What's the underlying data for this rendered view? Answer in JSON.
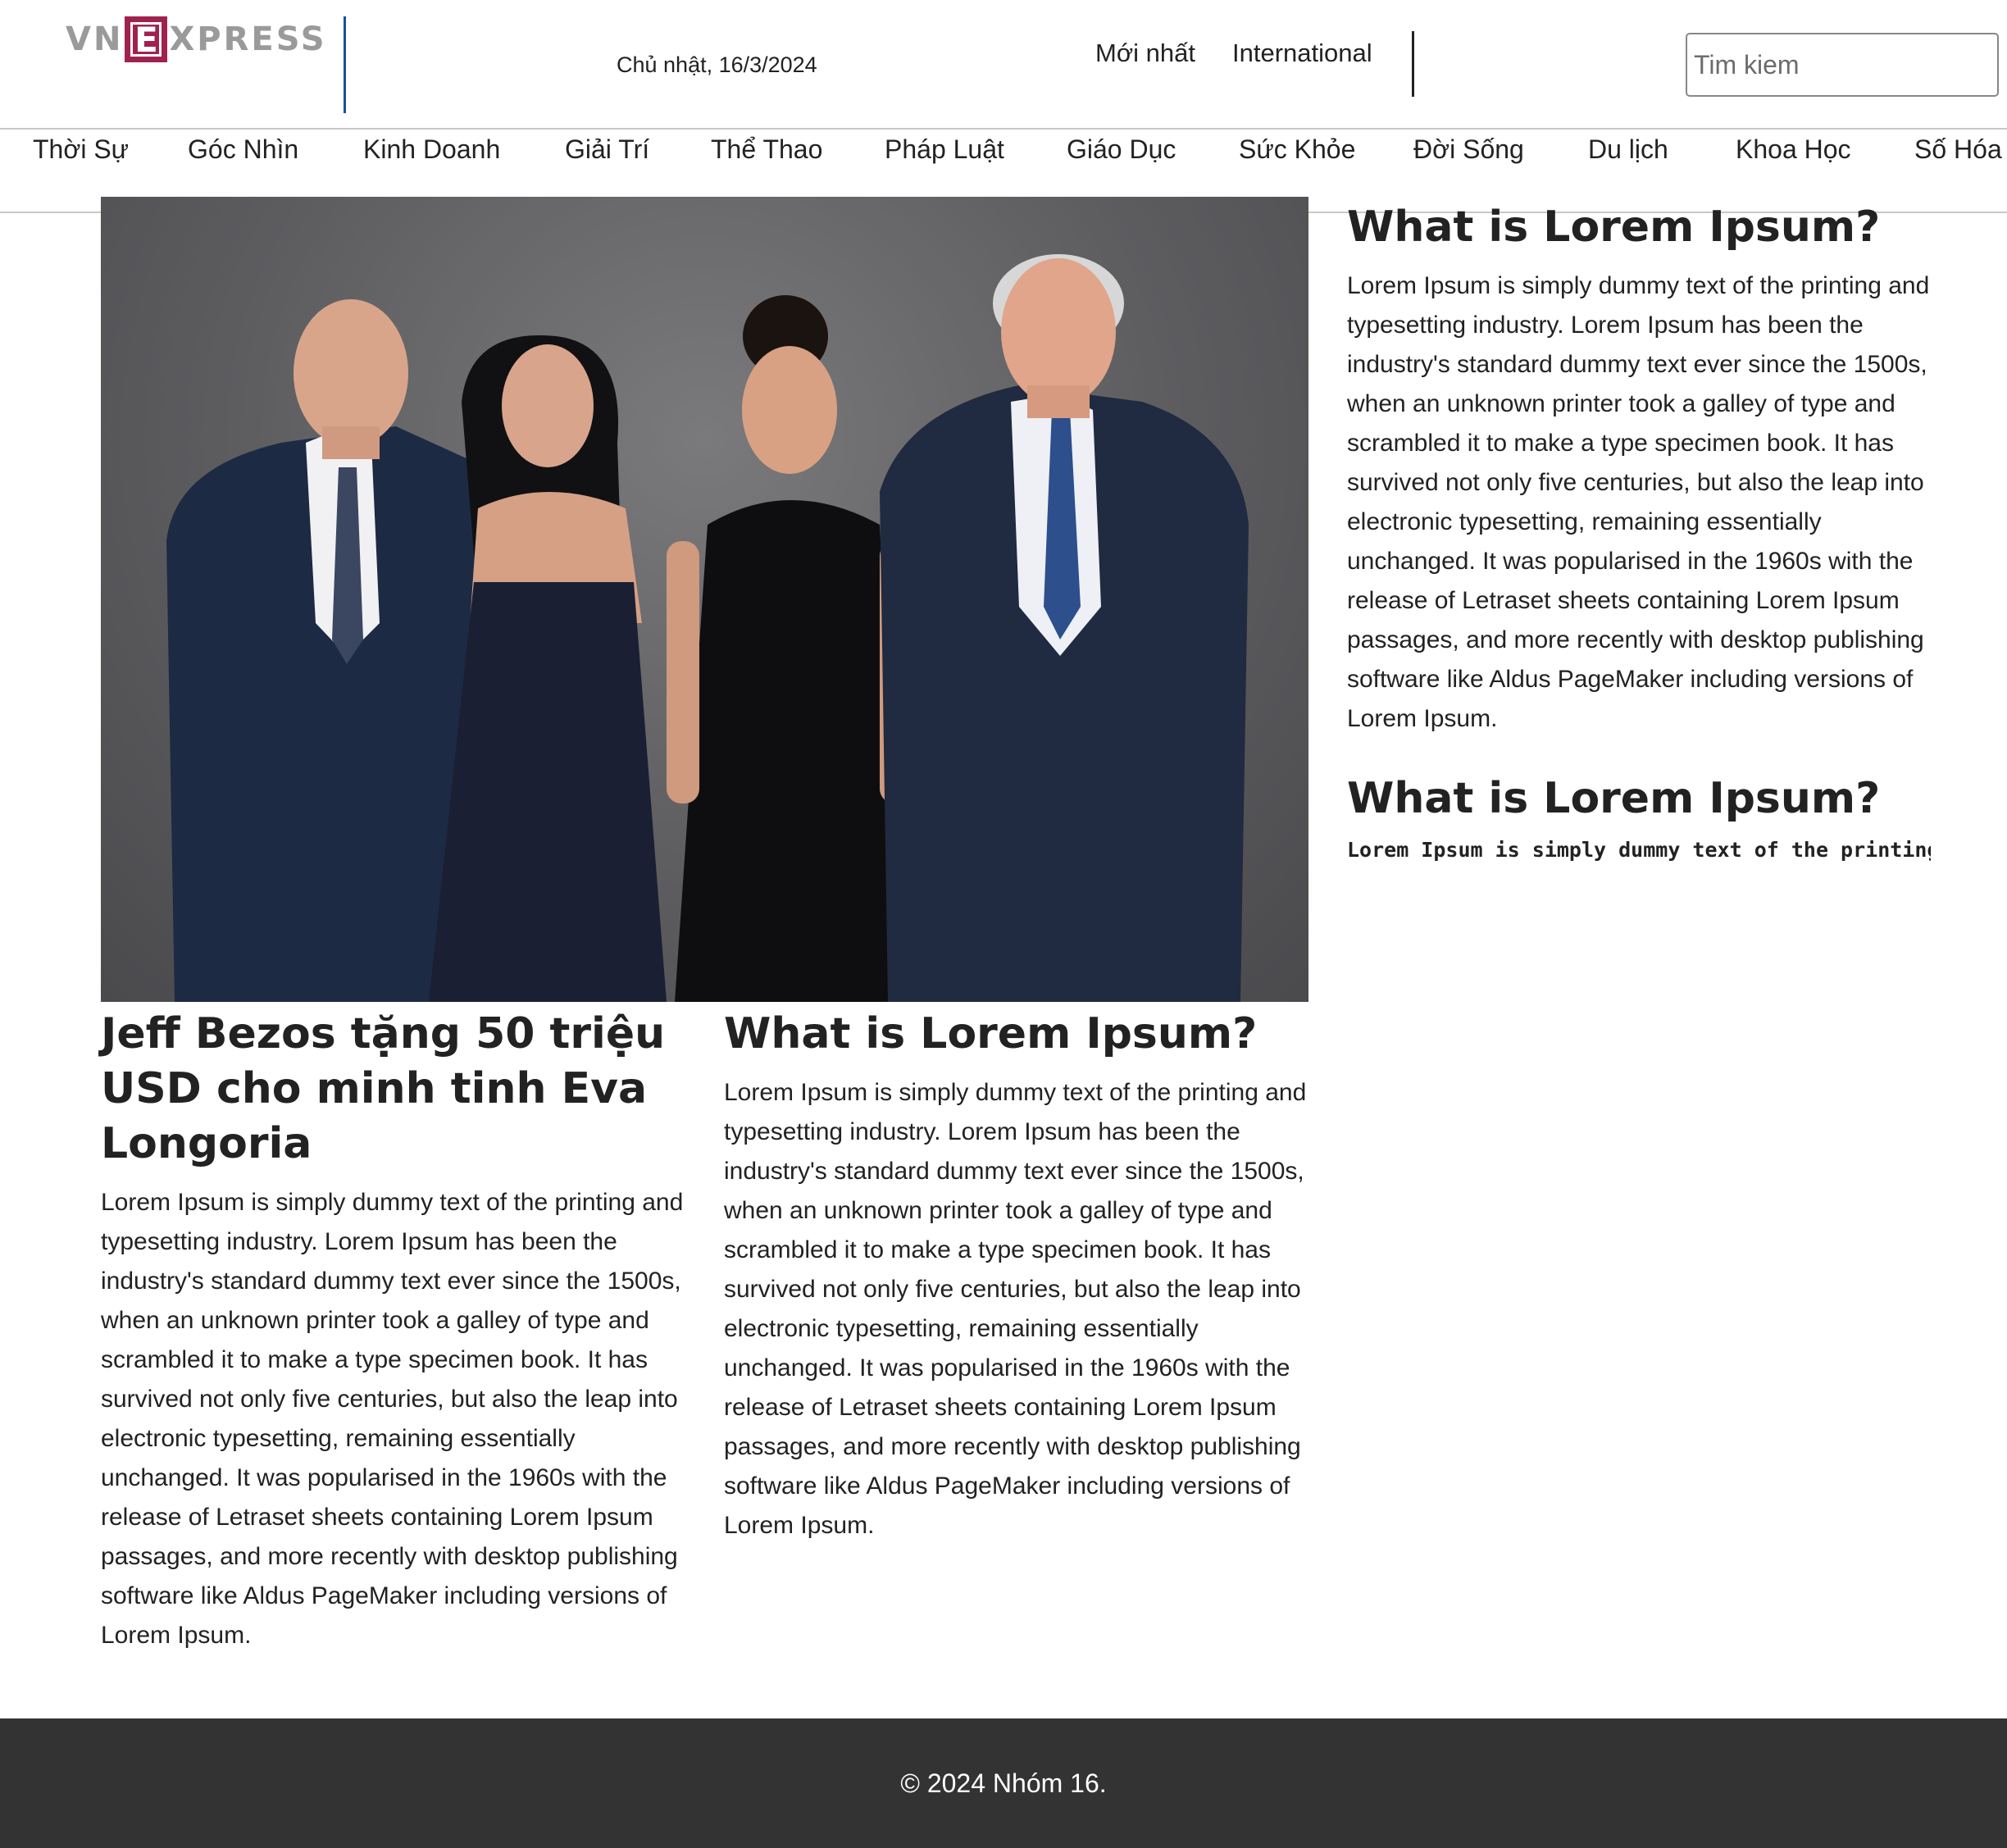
{
  "logo": {
    "left": "VN",
    "box": "E",
    "right": "XPRESS"
  },
  "date": "Chủ nhật, 16/3/2024",
  "top_links": [
    "Mới nhất",
    "International"
  ],
  "search": {
    "placeholder": "Tim kiem",
    "value": ""
  },
  "nav": [
    "Thời Sự",
    "Góc Nhìn",
    "Kinh Doanh",
    "Giải Trí",
    "Thể Thao",
    "Pháp Luật",
    "Giáo Dục",
    "Sức Khỏe",
    "Đời Sống",
    "Du lịch",
    "Khoa Học",
    "Số Hóa"
  ],
  "main_article": {
    "title": "Jeff Bezos tặng 50 triệu USD cho minh tinh Eva Longoria",
    "body": "Lorem Ipsum is simply dummy text of the printing and typesetting industry. Lorem Ipsum has been the industry's standard dummy text ever since the 1500s, when an unknown printer took a galley of type and scrambled it to make a type specimen book. It has survived not only five centuries, but also the leap into electronic typesetting, remaining essentially unchanged. It was popularised in the 1960s with the release of Letraset sheets containing Lorem Ipsum passages, and more recently with desktop publishing software like Aldus PageMaker including versions of Lorem Ipsum."
  },
  "mid_article": {
    "title": "What is Lorem Ipsum?",
    "body": "Lorem Ipsum is simply dummy text of the printing and typesetting industry. Lorem Ipsum has been the industry's standard dummy text ever since the 1500s, when an unknown printer took a galley of type and scrambled it to make a type specimen book. It has survived not only five centuries, but also the leap into electronic typesetting, remaining essentially unchanged. It was popularised in the 1960s with the release of Letraset sheets containing Lorem Ipsum passages, and more recently with desktop publishing software like Aldus PageMaker including versions of Lorem Ipsum."
  },
  "side_article_1": {
    "title": "What is Lorem Ipsum?",
    "body": "Lorem Ipsum is simply dummy text of the printing and typesetting industry. Lorem Ipsum has been the industry's standard dummy text ever since the 1500s, when an unknown printer took a galley of type and scrambled it to make a type specimen book. It has survived not only five centuries, but also the leap into electronic typesetting, remaining essentially unchanged. It was popularised in the 1960s with the release of Letraset sheets containing Lorem Ipsum passages, and more recently with desktop publishing software like Aldus PageMaker including versions of Lorem Ipsum."
  },
  "side_article_2": {
    "title": "What is Lorem Ipsum?",
    "body": "Lorem Ipsum is simply dummy text of the printing and typesetting industry."
  },
  "footer": {
    "text": "© 2024 Nhóm 16."
  },
  "colors": {
    "brand": "#9f224e",
    "divider_blue": "#1a4f9c",
    "footer_bg": "#333333"
  }
}
